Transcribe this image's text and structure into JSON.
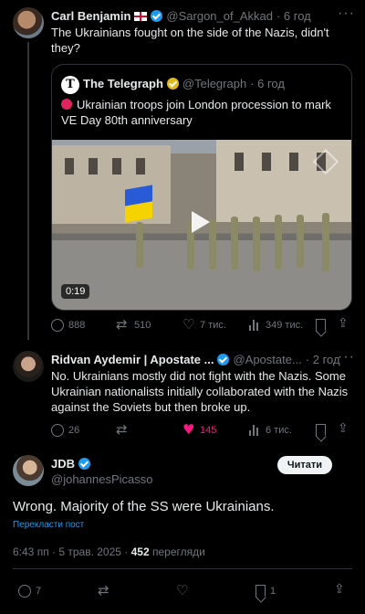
{
  "post1": {
    "name": "Carl Benjamin",
    "handle": "@Sargon_of_Akkad",
    "time": "· 6 год",
    "text": "The Ukrainians fought on the side of the Nazis, didn't they?",
    "quote": {
      "name": "The Telegraph",
      "handle": "@Telegraph",
      "time": "· 6 год",
      "text": "Ukrainian troops join London procession to mark VE Day 80th anniversary",
      "video_time": "0:19"
    },
    "stats": {
      "replies": "888",
      "reposts": "510",
      "likes": "7 тис.",
      "views": "349 тис."
    }
  },
  "post2": {
    "name": "Ridvan Aydemir | Apostate ...",
    "handle": "@Apostate...",
    "time": "· 2 год",
    "text": "No. Ukrainians mostly did not fight with the Nazis. Some Ukrainian nationalists initially collaborated with the Nazis against the Soviets but then broke up.",
    "stats": {
      "replies": "26",
      "reposts": "",
      "likes": "145",
      "views": "6 тис."
    }
  },
  "post3": {
    "name": "JDB",
    "handle": "@johannesPicasso",
    "follow_label": "Читати",
    "text": "Wrong. Majority of the SS were Ukrainians.",
    "translate_label": "Перекласти пост",
    "meta_time": "6:43 пп · 5 трав. 2025 ·",
    "views_count": "452",
    "views_label": "перегляди",
    "stats": {
      "replies": "7",
      "reposts": "",
      "likes": "",
      "bookmarks": "1"
    }
  },
  "colors": {
    "accent": "#1d9bf0",
    "like_active": "#f91880",
    "muted": "#71767b",
    "gold_badge": "#e2b719"
  }
}
